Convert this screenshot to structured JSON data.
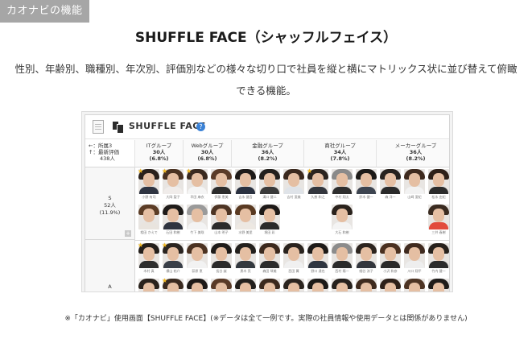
{
  "tag": "カオナビの機能",
  "headline": "SHUFFLE FACE（シャッフルフェイス）",
  "description": {
    "line1": "性別、年齢別、職種別、年次別、評価別などの様々な切り口で社員を縦と横にマトリックス状に並び替えて俯瞰",
    "line2": "できる機能。"
  },
  "app": {
    "title": "SHUFFLE FACE",
    "help": "?",
    "axis_legend": {
      "x": "←：所属3",
      "y": "↑：最新評価",
      "total": "438人"
    },
    "columns": [
      {
        "name": "ITグループ",
        "count": "30人",
        "pct": "(6.8%)"
      },
      {
        "name": "Webグループ",
        "count": "30人",
        "pct": "(6.8%)"
      },
      {
        "name": "金融グループ",
        "count": "36人",
        "pct": "(8.2%)"
      },
      {
        "name": "商社グループ",
        "count": "34人",
        "pct": "(7.8%)"
      },
      {
        "name": "メーカーグループ",
        "count": "36人",
        "pct": "(8.2%)"
      }
    ],
    "rows": [
      {
        "grade": "S",
        "count": "52人",
        "pct": "(11.9%)"
      },
      {
        "grade": "A"
      }
    ],
    "expand_symbol": "+",
    "star_symbol": "★",
    "faces": [
      {
        "name": "小野 有司",
        "hair": "#2a211c",
        "top": "#2f3542",
        "star": true
      },
      {
        "name": "大岡 聖子",
        "hair": "#4a3222",
        "top": "#f0ecea",
        "star": true
      },
      {
        "name": "早田 麻衣",
        "hair": "#3a2a20",
        "top": "#f5f5f5",
        "star": true
      },
      {
        "name": "伊藤 恵美",
        "hair": "#5a3b28",
        "top": "#2c2c2c",
        "star": false
      },
      {
        "name": "吉永 健吾",
        "hair": "#1e1a18",
        "top": "#2a3140",
        "star": false
      },
      {
        "name": "溝口 健二",
        "hair": "#23201d",
        "top": "#3a3a3a",
        "star": false
      },
      {
        "name": "吉村 亜美",
        "hair": "#3b291e",
        "top": "#dfe3e8",
        "star": false
      },
      {
        "name": "久慈 和之",
        "hair": "#2b241f",
        "top": "#33363d",
        "star": true
      },
      {
        "name": "中村 翔太",
        "hair": "#8a8a8a",
        "top": "#2e2e2e",
        "star": false
      },
      {
        "name": "鈴木 健一",
        "hair": "#1c1a18",
        "top": "#3d4450",
        "star": false
      },
      {
        "name": "森 洋一",
        "hair": "#26211d",
        "top": "#2a2a2a",
        "star": false
      },
      {
        "name": "山崎 亜紀",
        "hair": "#3e2a1e",
        "top": "#f2f2f2",
        "star": false
      },
      {
        "name": "松永 由紀",
        "hair": "#2d2019",
        "top": "#2c2c2c",
        "star": false
      },
      {
        "name": "相田 かえで",
        "hair": "#5c3d26",
        "top": "#e9e4de",
        "star": false
      },
      {
        "name": "石田 和樹",
        "hair": "#1f1c1a",
        "top": "#2f3440",
        "star": false
      },
      {
        "name": "竹下 美咲",
        "hair": "#9a9a9a",
        "top": "#f3f3f3",
        "star": false
      },
      {
        "name": "山本 明子",
        "hair": "#4d3424",
        "top": "#2b2b2b",
        "star": false
      },
      {
        "name": "水野 美里",
        "hair": "#5a3a22",
        "top": "#ede8e2",
        "star": false
      },
      {
        "name": "堀田 彩",
        "hair": "#1d1917",
        "top": "#2a2a2a",
        "star": false
      },
      {
        "name": "大石 和樹",
        "hair": "#2a221c",
        "top": "#f4f4f4",
        "star": false
      },
      {
        "name": "三井 春樹",
        "hair": "#3a2b20",
        "top": "#e24a3b",
        "star": false
      },
      {
        "name": "木村 真",
        "hair": "#241f1b",
        "top": "#2e2e2e",
        "star": true
      },
      {
        "name": "横山 祐介",
        "hair": "#2a2420",
        "top": "#3a3f48",
        "star": true
      },
      {
        "name": "荻原 恵",
        "hair": "#4b3221",
        "top": "#f2f2f2",
        "star": false
      },
      {
        "name": "長谷 誠",
        "hair": "#1e1b19",
        "top": "#2a2a2a",
        "star": false
      },
      {
        "name": "黒木 亮",
        "hair": "#23201d",
        "top": "#34393f",
        "star": false
      },
      {
        "name": "森田 琴美",
        "hair": "#3c291d",
        "top": "#2c2c2c",
        "star": false
      },
      {
        "name": "西田 翼",
        "hair": "#2a231e",
        "top": "#f0f0f0",
        "star": false
      },
      {
        "name": "野口 達也",
        "hair": "#1d1a18",
        "top": "#2f3540",
        "star": false
      },
      {
        "name": "西村 陽一",
        "hair": "#8c8c8c",
        "top": "#2b2b2b",
        "star": false
      },
      {
        "name": "細谷 涼子",
        "hair": "#2c241f",
        "top": "#33363d",
        "star": false
      },
      {
        "name": "小沢 和彦",
        "hair": "#4a3020",
        "top": "#2a2a2a",
        "star": false
      },
      {
        "name": "川口 翔平",
        "hair": "#3f2a1f",
        "top": "#eeeeee",
        "star": false
      },
      {
        "name": "竹内 健一",
        "hair": "#27211c",
        "top": "#2c2c2c",
        "star": false
      },
      {
        "name": "",
        "hair": "#2a221c",
        "top": "#2f3542",
        "star": false
      },
      {
        "name": "",
        "hair": "#3a2a20",
        "top": "#f0ecea",
        "star": true
      },
      {
        "name": "",
        "hair": "#1e1a18",
        "top": "#2c2c2c",
        "star": false
      },
      {
        "name": "",
        "hair": "#5a3b28",
        "top": "#2a3140",
        "star": false
      },
      {
        "name": "",
        "hair": "#23201d",
        "top": "#3a3a3a",
        "star": false
      },
      {
        "name": "",
        "hair": "#3b291e",
        "top": "#dfe3e8",
        "star": false
      },
      {
        "name": "",
        "hair": "#2b241f",
        "top": "#33363d",
        "star": false
      },
      {
        "name": "",
        "hair": "#1c1a18",
        "top": "#2e2e2e",
        "star": false
      },
      {
        "name": "",
        "hair": "#26211d",
        "top": "#3d4450",
        "star": false
      },
      {
        "name": "",
        "hair": "#3e2a1e",
        "top": "#2a2a2a",
        "star": false
      },
      {
        "name": "",
        "hair": "#2d2019",
        "top": "#f2f2f2",
        "star": false
      },
      {
        "name": "",
        "hair": "#4d3424",
        "top": "#2c2c2c",
        "star": false
      },
      {
        "name": "",
        "hair": "#1f1c1a",
        "top": "#2f3440",
        "star": false
      }
    ]
  },
  "caption": "※「カオナビ」使用画面【SHUFFLE FACE】(※データは全て一例です。実際の社員情報や使用データとは関係がありません)"
}
